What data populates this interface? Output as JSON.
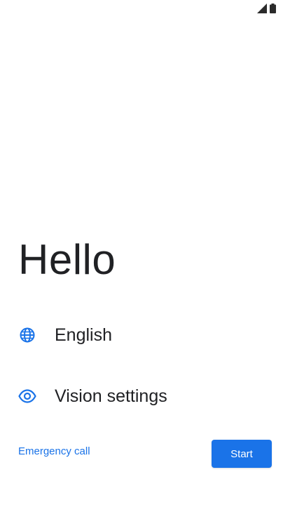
{
  "status_bar": {
    "icons": [
      "signal-icon",
      "battery-icon"
    ]
  },
  "welcome": {
    "greeting": "Hello"
  },
  "options": [
    {
      "icon": "globe-icon",
      "label": "English"
    },
    {
      "icon": "eye-icon",
      "label": "Vision settings"
    }
  ],
  "actions": {
    "emergency_label": "Emergency call",
    "start_label": "Start"
  },
  "colors": {
    "accent": "#1a73e8",
    "text": "#202124",
    "background": "#ffffff"
  }
}
